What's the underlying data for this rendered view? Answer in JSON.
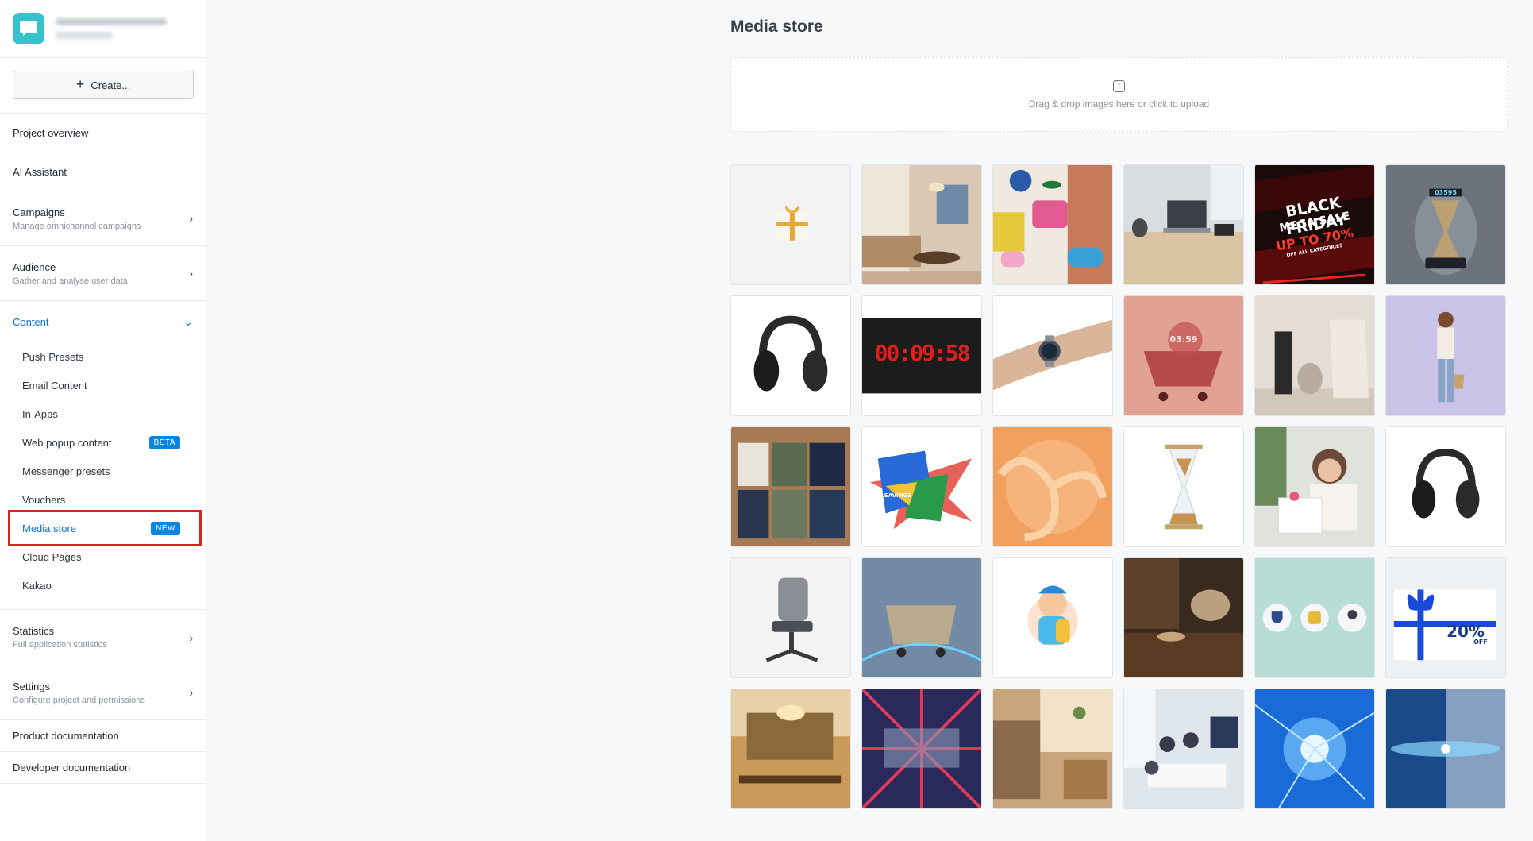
{
  "sidebar": {
    "create_label": "Create...",
    "items_top": [
      {
        "label": "Project overview",
        "sub": ""
      },
      {
        "label": "AI Assistant",
        "sub": ""
      },
      {
        "label": "Campaigns",
        "sub": "Manage omnichannel campaigns"
      },
      {
        "label": "Audience",
        "sub": "Gather and analyse user data"
      }
    ],
    "content": {
      "label": "Content",
      "items": [
        {
          "label": "Push Presets",
          "badge": ""
        },
        {
          "label": "Email Content",
          "badge": ""
        },
        {
          "label": "In-Apps",
          "badge": ""
        },
        {
          "label": "Web popup content",
          "badge": "BETA"
        },
        {
          "label": "Messenger presets",
          "badge": ""
        },
        {
          "label": "Vouchers",
          "badge": ""
        },
        {
          "label": "Media store",
          "badge": "NEW"
        },
        {
          "label": "Cloud Pages",
          "badge": ""
        },
        {
          "label": "Kakao",
          "badge": ""
        }
      ]
    },
    "items_bottom": [
      {
        "label": "Statistics",
        "sub": "Full application statistics"
      },
      {
        "label": "Settings",
        "sub": "Configure project and permissions"
      },
      {
        "label": "Product documentation",
        "sub": ""
      },
      {
        "label": "Developer documentation",
        "sub": ""
      }
    ]
  },
  "main": {
    "title": "Media store",
    "upload_hint": "Drag & drop images here or click to upload",
    "tile_texts": {
      "black_friday_1": "BLACK FRIDAY",
      "black_friday_2": "MEGA SALE",
      "black_friday_3": "UP TO 70%",
      "black_friday_4": "OFF ALL CATEGORIES",
      "hourglass_display": "03595",
      "clock": "00:09:58",
      "cart_timer": "03:59",
      "savings": "SAVINGS",
      "discount": "20%",
      "discount_off": "OFF"
    },
    "images": [
      "gift-box",
      "living-room",
      "fashion-accessories",
      "desk-laptop",
      "black-friday-banner",
      "hourglass-timer",
      "headphones",
      "digital-clock",
      "smartwatch",
      "shopping-cart-timer",
      "home-decor",
      "woman-shopping",
      "folded-clothes",
      "savings-graphic",
      "orange-swirl",
      "hourglass",
      "woman-opening-gift",
      "headphones-2",
      "office-chair",
      "futuristic-cart",
      "cartoon-character",
      "rustic-table",
      "security-icons",
      "discount-gift",
      "restaurant-interior",
      "abstract-burst",
      "cozy-room",
      "office-meeting",
      "blue-light-burst",
      "blue-particles"
    ]
  }
}
